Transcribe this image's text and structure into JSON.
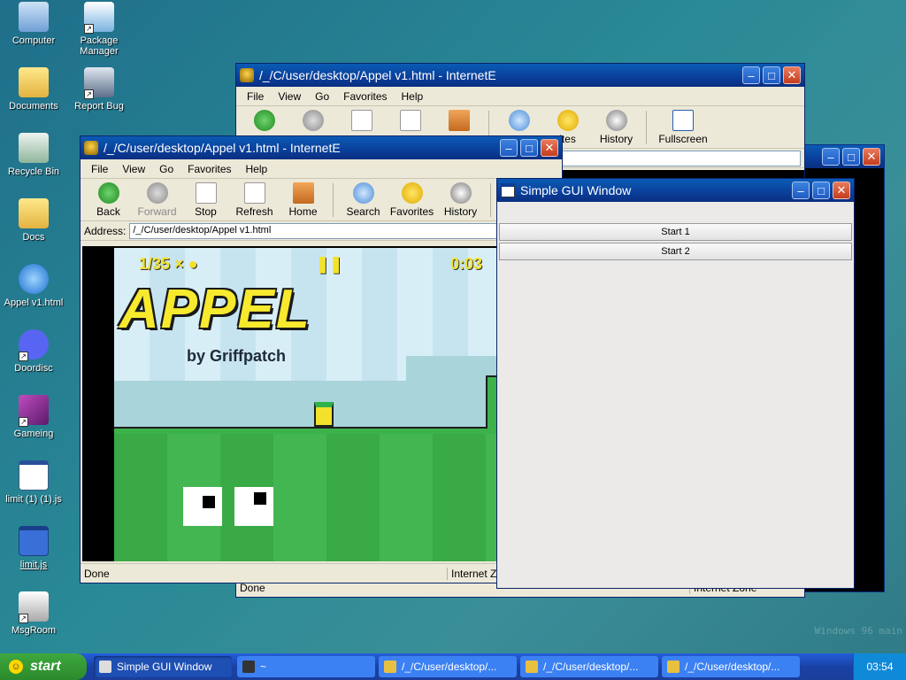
{
  "desktop": {
    "icons": [
      {
        "label": "Computer"
      },
      {
        "label": "Package Manager"
      },
      {
        "label": "Documents"
      },
      {
        "label": "Report Bug"
      },
      {
        "label": "Recycle Bin"
      },
      {
        "label": "Docs"
      },
      {
        "label": "Appel v1.html"
      },
      {
        "label": "Doordisc"
      },
      {
        "label": "Gameing"
      },
      {
        "label": "limit (1) (1).js"
      },
      {
        "label": "limit.js"
      },
      {
        "label": "MsgRoom"
      }
    ],
    "watermark_line1": "Windows 96 main"
  },
  "browser_back": {
    "title": "/_/C/user/desktop/Appel v1.html - InternetE",
    "menu": [
      "File",
      "View",
      "Go",
      "Favorites",
      "Help"
    ],
    "tools": [
      "History",
      "Fullscreen"
    ],
    "tools_partial": "ites",
    "status_left": "Done",
    "status_zone": "Internet Zone"
  },
  "browser_front": {
    "title": "/_/C/user/desktop/Appel v1.html - InternetE",
    "menu": [
      "File",
      "View",
      "Go",
      "Favorites",
      "Help"
    ],
    "tools": [
      "Back",
      "Forward",
      "Stop",
      "Refresh",
      "Home",
      "Search",
      "Favorites",
      "History"
    ],
    "tool_partial": "F",
    "address_label": "Address:",
    "address_value": "/_/C/user/desktop/Appel v1.html",
    "status_left": "Done",
    "status_zone": "Internet Zo"
  },
  "game": {
    "counter": "1/35 ×",
    "timer": "0:03",
    "title": "APPEL",
    "subtitle": "by Griffpatch"
  },
  "simple_gui": {
    "title": "Simple GUI Window",
    "buttons": [
      "Start 1",
      "Start 2"
    ]
  },
  "taskbar": {
    "start_label": "start",
    "items": [
      "Simple GUI Window",
      "~",
      "/_/C/user/desktop/...",
      "/_/C/user/desktop/...",
      "/_/C/user/desktop/..."
    ],
    "clock": "03:54"
  }
}
